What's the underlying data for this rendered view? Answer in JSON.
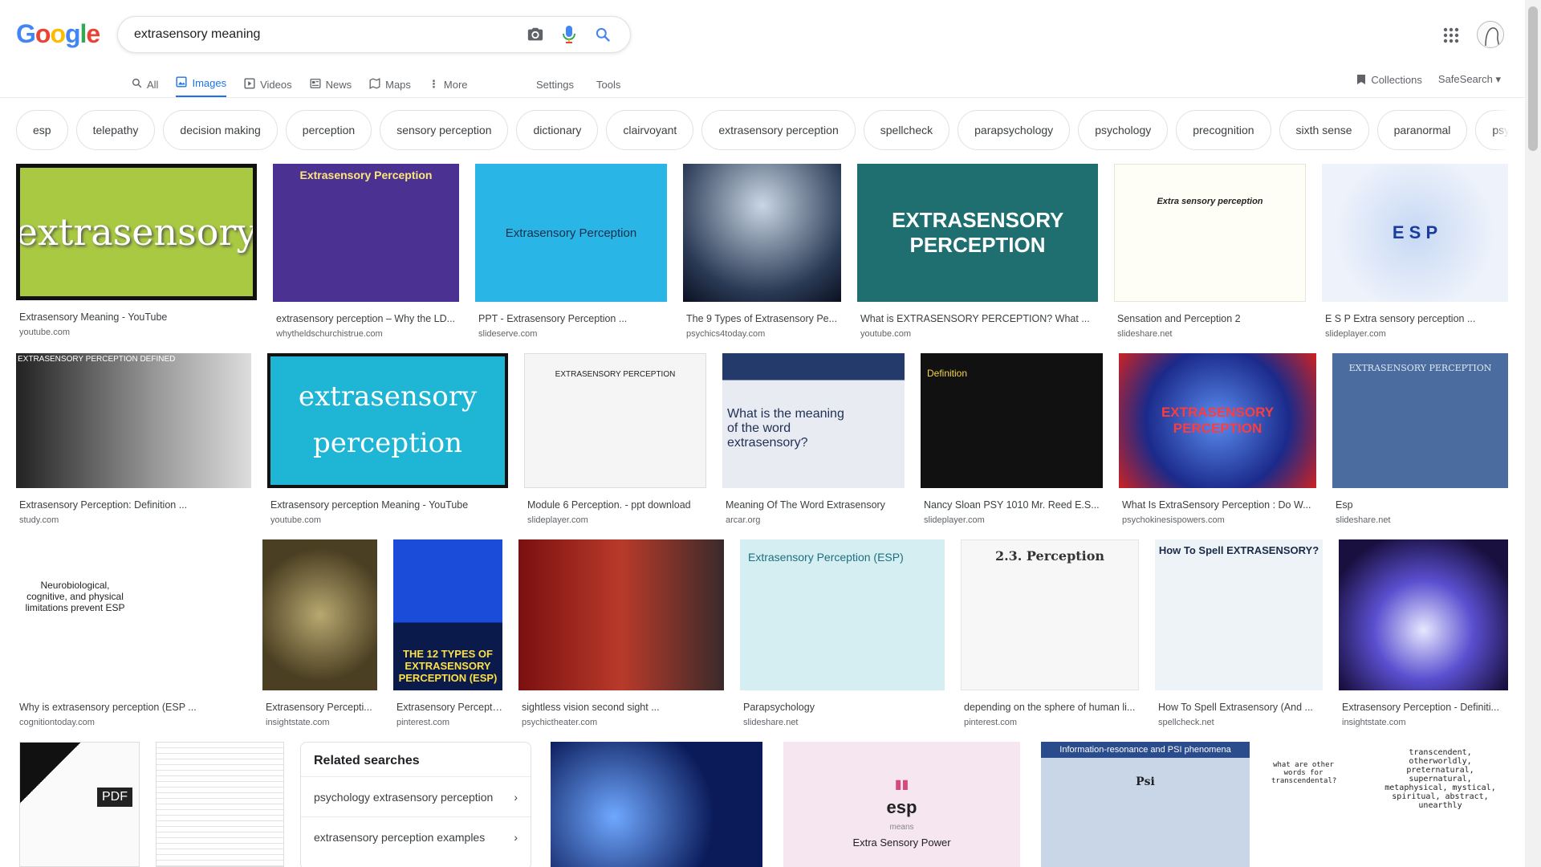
{
  "logo": {
    "letters": [
      "G",
      "o",
      "o",
      "g",
      "l",
      "e"
    ]
  },
  "search": {
    "query": "extrasensory meaning"
  },
  "tabs": [
    {
      "label": "All",
      "icon": "search-icon"
    },
    {
      "label": "Images",
      "icon": "image-icon"
    },
    {
      "label": "Videos",
      "icon": "video-icon"
    },
    {
      "label": "News",
      "icon": "news-icon"
    },
    {
      "label": "Maps",
      "icon": "map-icon"
    },
    {
      "label": "More",
      "icon": "more-vertical-icon"
    }
  ],
  "tools": {
    "settings": "Settings",
    "tools": "Tools"
  },
  "header_right": {
    "collections": "Collections",
    "safesearch": "SafeSearch"
  },
  "chips": [
    "esp",
    "telepathy",
    "decision making",
    "perception",
    "sensory perception",
    "dictionary",
    "clairvoyant",
    "extrasensory perception",
    "spellcheck",
    "parapsychology",
    "psychology",
    "precognition",
    "sixth sense",
    "paranormal",
    "psych"
  ],
  "row1": [
    {
      "title": "Extrasensory Meaning - YouTube",
      "source": "youtube.com",
      "thumb_text": "extrasensory"
    },
    {
      "title": "extrasensory perception – Why the LD...",
      "source": "whytheldschurchistrue.com",
      "thumb_text": "Extrasensory Perception"
    },
    {
      "title": "PPT - Extrasensory Perception ...",
      "source": "slideserve.com",
      "thumb_text": "Extrasensory Perception"
    },
    {
      "title": "The 9 Types of Extrasensory Pe...",
      "source": "psychics4today.com",
      "thumb_text": ""
    },
    {
      "title": "What is EXTRASENSORY PERCEPTION? What ...",
      "source": "youtube.com",
      "thumb_text": "EXTRASENSORY PERCEPTION"
    },
    {
      "title": "Sensation and Perception 2",
      "source": "slideshare.net",
      "thumb_text": "Extra sensory perception"
    },
    {
      "title": "E S P Extra sensory perception ...",
      "source": "slideplayer.com",
      "thumb_text": "E S P"
    }
  ],
  "row2": [
    {
      "title": "Extrasensory Perception: Definition ...",
      "source": "study.com",
      "thumb_text": "EXTRASENSORY PERCEPTION DEFINED"
    },
    {
      "title": "Extrasensory perception Meaning - YouTube",
      "source": "youtube.com",
      "thumb_text": "extrasensory perception"
    },
    {
      "title": "Module 6 Perception. - ppt download",
      "source": "slideplayer.com",
      "thumb_text": "EXTRASENSORY PERCEPTION"
    },
    {
      "title": "Meaning Of The Word Extrasensory",
      "source": "arcar.org",
      "thumb_text": "What is the meaning of the word extrasensory?"
    },
    {
      "title": "Nancy Sloan PSY 1010 Mr. Reed E.S...",
      "source": "slideplayer.com",
      "thumb_text": "Definition"
    },
    {
      "title": "What Is ExtraSensory Perception : Do W...",
      "source": "psychokinesispowers.com",
      "thumb_text": "EXTRASENSORY PERCEPTION"
    },
    {
      "title": "Esp",
      "source": "slideshare.net",
      "thumb_text": "EXTRASENSORY PERCEPTION"
    }
  ],
  "row3": [
    {
      "title": "Why is extrasensory perception (ESP ...",
      "source": "cognitiontoday.com",
      "thumb_text": "Neurobiological, cognitive, and physical limitations prevent ESP"
    },
    {
      "title": "Extrasensory Percepti...",
      "source": "insightstate.com",
      "thumb_text": ""
    },
    {
      "title": "Extrasensory Percepti...",
      "source": "pinterest.com",
      "thumb_text": "THE 12 TYPES OF EXTRASENSORY PERCEPTION (ESP)"
    },
    {
      "title": "sightless vision second sight ...",
      "source": "psychictheater.com",
      "thumb_text": ""
    },
    {
      "title": "Parapsychology",
      "source": "slideshare.net",
      "thumb_text": "Extrasensory Perception (ESP)"
    },
    {
      "title": "depending on the sphere of human li...",
      "source": "pinterest.com",
      "thumb_text": "2.3. Perception"
    },
    {
      "title": "How To Spell Extrasensory (And ...",
      "source": "spellcheck.net",
      "thumb_text": "How To Spell EXTRASENSORY?"
    },
    {
      "title": "Extrasensory Perception - Definiti...",
      "source": "insightstate.com",
      "thumb_text": ""
    }
  ],
  "related": {
    "heading": "Related searches",
    "items": [
      "psychology extrasensory perception",
      "extrasensory perception examples"
    ]
  },
  "row4": {
    "pdf_badge": "PDF",
    "esp_title": "esp",
    "esp_means": "means",
    "esp_def": "Extra Sensory Power",
    "psi_title": "Information-resonance and PSI phenomena",
    "psi_center": "Psi",
    "synonyms": "transcendent, otherworldly, preternatural, supernatural, metaphysical, mystical, spiritual, abstract, unearthly",
    "bird_question": "what are other words for transcendental?"
  }
}
